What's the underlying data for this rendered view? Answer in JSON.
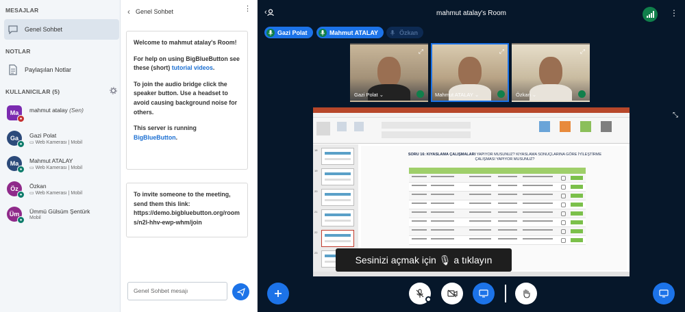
{
  "sidebar": {
    "messages_heading": "MESAJLAR",
    "public_chat": "Genel Sohbet",
    "notes_heading": "NOTLAR",
    "shared_notes": "Paylaşılan Notlar",
    "users_heading": "KULLANICILAR (5)",
    "users": [
      {
        "initials": "Ma",
        "name": "mahmut atalay",
        "you": "(Sen)",
        "sub": "",
        "color": "#7b2bb0",
        "badge_color": "#c53030",
        "shape": "square"
      },
      {
        "initials": "Ga",
        "name": "Gazi Polat",
        "you": "",
        "sub": "Web Kamerası | Mobil",
        "color": "#2c4a7a",
        "badge_color": "#0e7c6b",
        "shape": "round"
      },
      {
        "initials": "Ma",
        "name": "Mahmut ATALAY",
        "you": "",
        "sub": "Web Kamerası | Mobil",
        "color": "#2c4a7a",
        "badge_color": "#0e7c6b",
        "shape": "round"
      },
      {
        "initials": "Öz",
        "name": "Özkan",
        "you": "",
        "sub": "Web Kamerası | Mobil",
        "color": "#8f2a8a",
        "badge_color": "#0e7c6b",
        "shape": "round"
      },
      {
        "initials": "Üm",
        "name": "Ümmü Gülsüm Şentürk",
        "you": "",
        "sub": "Mobil",
        "color": "#8f2a8a",
        "badge_color": "#0e7c6b",
        "shape": "round"
      }
    ]
  },
  "chat": {
    "title": "Genel Sohbet",
    "welcome_prefix": "Welcome to ",
    "welcome_room": "mahmut atalay's Room",
    "welcome_suffix": "!",
    "help_text": "For help on using BigBlueButton see these (short) ",
    "help_link": "tutorial videos",
    "help_end": ".",
    "audio_text": "To join the audio bridge click the speaker button. Use a headset to avoid causing background noise for others.",
    "server_text": "This server is running ",
    "server_link": "BigBlueButton",
    "server_end": ".",
    "invite_text": "To invite someone to the meeting, send them this link:",
    "invite_link": "https://demo.bigbluebutton.org/rooms/n2l-hhv-ewp-whm/join",
    "input_placeholder": "Genel Sohbet mesajı"
  },
  "main": {
    "room_title": "mahmut atalay's Room",
    "talkers": [
      {
        "name": "Gazi Polat",
        "active": true
      },
      {
        "name": "Mahmut ATALAY",
        "active": true
      },
      {
        "name": "Özkan",
        "active": false
      }
    ],
    "videos": [
      {
        "name": "Gazi Polat",
        "talking": false
      },
      {
        "name": "Mahmut ATALAY",
        "talking": true
      },
      {
        "name": "Özkan",
        "talking": false
      }
    ],
    "presentation": {
      "heading_bold": "SORU 16: KIYASLAMA ÇALIŞMALARI",
      "heading_rest": " YAPIYOR MUSUNUZ? KIYASLAMA SONUÇLARINA GÖRE İYİLEŞTİRME ÇALIŞMASI YAPIYOR MUSUNUZ?",
      "slide_numbers": [
        "18",
        "19",
        "20",
        "21",
        "22",
        "23"
      ]
    },
    "toast": "Sesinizi açmak için 🎙 a tıklayın",
    "colors": {
      "accent": "#1c73e8",
      "bg": "#06172a",
      "talk_green": "#107f4b"
    }
  }
}
